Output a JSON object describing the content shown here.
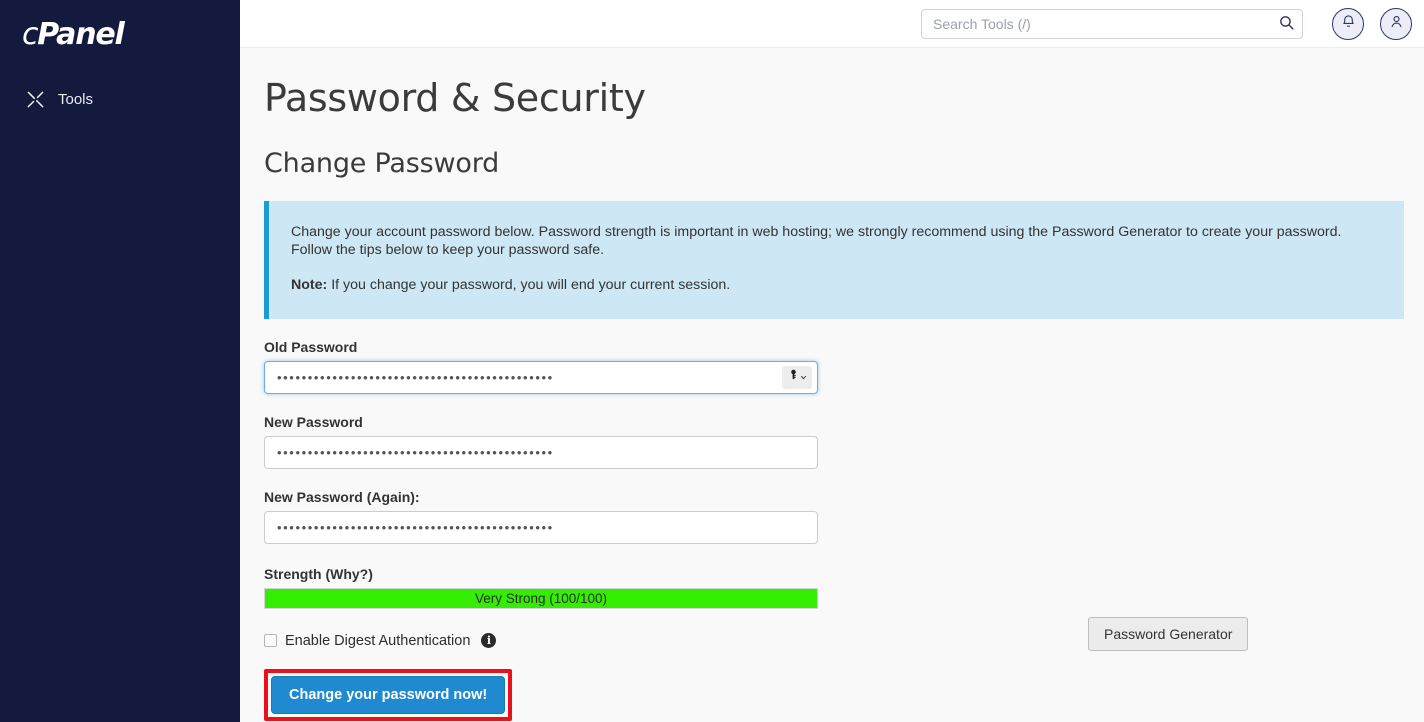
{
  "sidebar": {
    "brand_c": "c",
    "brand_rest": "Panel",
    "nav": [
      {
        "label": "Tools",
        "icon": "tools-icon"
      }
    ]
  },
  "header": {
    "search": {
      "placeholder": "Search Tools (/)",
      "value": "",
      "icon": "search-icon"
    },
    "notifications_icon": "bell-icon",
    "account_icon": "user-icon"
  },
  "page": {
    "title": "Password & Security",
    "section_title": "Change Password"
  },
  "alert": {
    "body": "Change your account password below. Password strength is important in web hosting; we strongly recommend using the Password Generator to create your password. Follow the tips below to keep your password safe.",
    "note_label": "Note:",
    "note_body": "If you change your password, you will end your current session.",
    "accent_color": "#1a9ad6",
    "background_color": "#cde7f5"
  },
  "form": {
    "old_password": {
      "label": "Old Password",
      "value": "•••••••••••••••••••••••••••••••••••••••••••••",
      "focused": true,
      "key_icon": "key-icon",
      "chevron_icon": "chevron-down-icon"
    },
    "new_password": {
      "label": "New Password",
      "value": "•••••••••••••••••••••••••••••••••••••••••••••"
    },
    "new_password_again": {
      "label": "New Password (Again):",
      "value": "•••••••••••••••••••••••••••••••••••••••••••••"
    },
    "strength": {
      "label": "Strength (Why?)",
      "text": "Very Strong (100/100)",
      "percent": 100,
      "fill_color": "#33ee00"
    },
    "password_generator_label": "Password Generator",
    "digest": {
      "label": "Enable Digest Authentication",
      "checked": false,
      "info_icon": "info-icon",
      "info_glyph": "i"
    },
    "submit": {
      "label": "Change your password now!",
      "button_color": "#1f8ad0",
      "highlight_color": "#e8111c"
    }
  }
}
